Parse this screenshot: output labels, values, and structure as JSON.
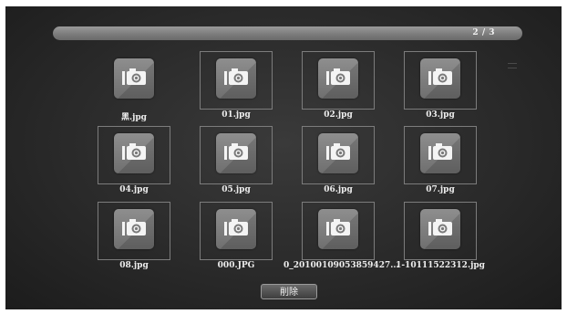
{
  "pager": {
    "indicator": "2 / 3"
  },
  "files": [
    {
      "name": "黑.jpg",
      "icon": "photo-camera-icon",
      "framed": false
    },
    {
      "name": "01.jpg",
      "icon": "photo-camera-icon",
      "framed": true
    },
    {
      "name": "02.jpg",
      "icon": "photo-camera-icon",
      "framed": true
    },
    {
      "name": "03.jpg",
      "icon": "photo-camera-icon",
      "framed": true
    },
    {
      "name": "04.jpg",
      "icon": "photo-camera-icon",
      "framed": true
    },
    {
      "name": "05.jpg",
      "icon": "photo-camera-icon",
      "framed": true
    },
    {
      "name": "06.jpg",
      "icon": "photo-camera-icon",
      "framed": true
    },
    {
      "name": "07.jpg",
      "icon": "photo-camera-icon",
      "framed": true
    },
    {
      "name": "08.jpg",
      "icon": "photo-camera-icon",
      "framed": true
    },
    {
      "name": "000.JPG",
      "icon": "photo-camera-icon",
      "framed": true
    },
    {
      "name": "0_20100109053859427...",
      "icon": "photo-camera-icon",
      "framed": true
    },
    {
      "name": "1-10111522312.jpg",
      "icon": "photo-camera-icon",
      "framed": true
    }
  ],
  "actions": {
    "delete_label": "削除"
  },
  "colors": {
    "background": "#2a2a2a",
    "thumbnail": "#7f7f7f",
    "label": "#ededed"
  }
}
